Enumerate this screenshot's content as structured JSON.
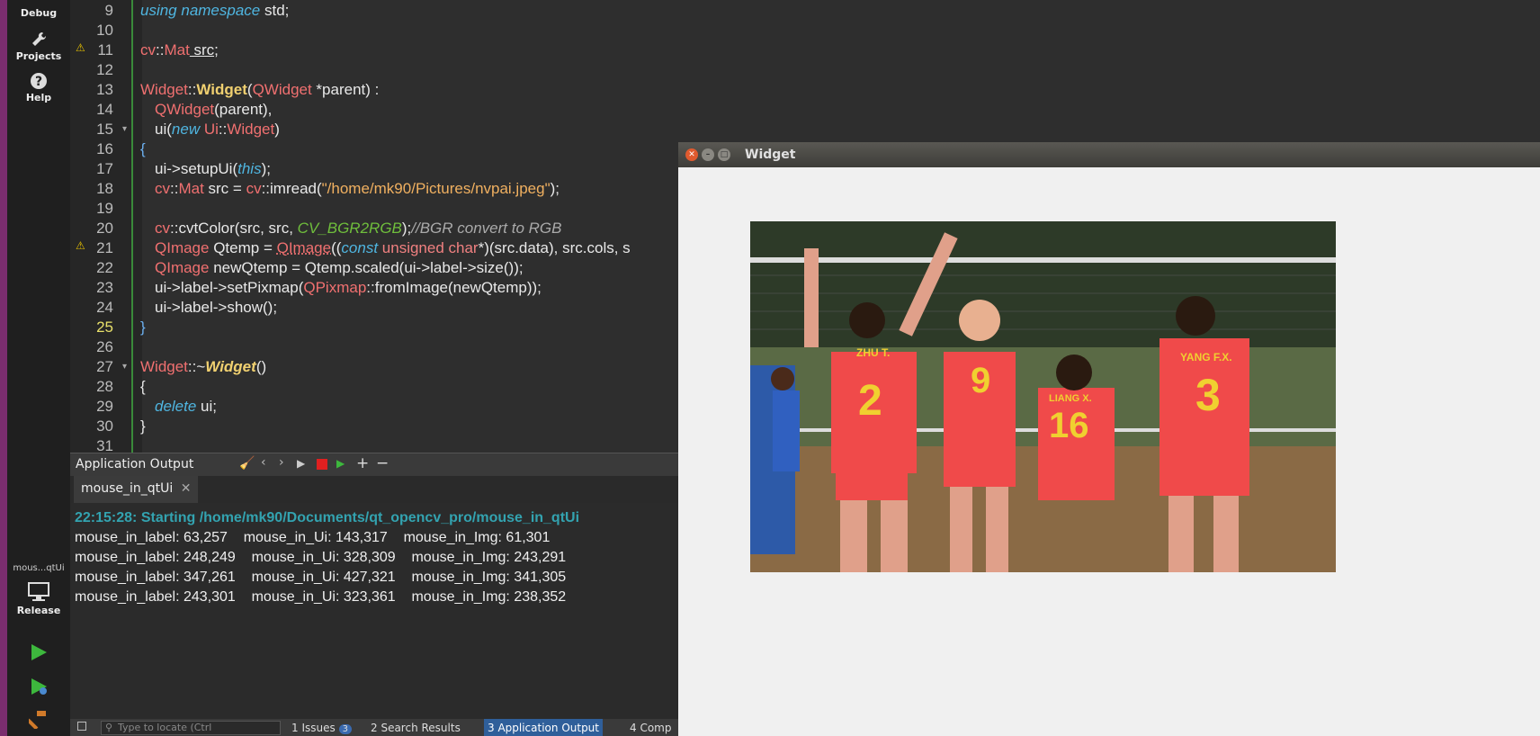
{
  "sidebar": {
    "debug_label": "Debug",
    "projects_label": "Projects",
    "help_label": "Help",
    "kit_project": "mous...qtUi",
    "kit_config": "Release"
  },
  "editor": {
    "line_numbers": [
      "9",
      "10",
      "11",
      "12",
      "13",
      "14",
      "15",
      "16",
      "17",
      "18",
      "19",
      "20",
      "21",
      "22",
      "23",
      "24",
      "25",
      "26",
      "27",
      "28",
      "29",
      "30",
      "31"
    ],
    "current_line": "25",
    "code": {
      "l9_kw": "using namespace",
      "l9_rest": " std;",
      "l11_type": "cv",
      "l11_sep": "::",
      "l11_mat": "Mat",
      "l11_rest": " src;",
      "l13_a": "Widget",
      "l13_b": "::",
      "l13_c": "Widget",
      "l13_d": "(",
      "l13_e": "QWidget",
      "l13_f": " *parent) :",
      "l14_a": "QWidget",
      "l14_b": "(parent),",
      "l15_a": "ui(",
      "l15_b": "new",
      "l15_c": " Ui",
      "l15_d": "::",
      "l15_e": "Widget",
      ")": ")",
      "l16": "{",
      "l17_a": "ui->setupUi(",
      "l17_b": "this",
      "l17_c": ");",
      "l18_a": "cv",
      "l18_b": "::",
      "l18_c": "Mat",
      "l18_d": " src = ",
      "l18_e": "cv",
      "l18_f": "::imread(",
      "l18_g": "\"/home/mk90/Pictures/nvpai.jpeg\"",
      "l18_h": ");",
      "l20_a": "cv",
      "l20_b": "::cvtColor(src, src, ",
      "l20_c": "CV_BGR2RGB",
      "l20_d": ");",
      "l20_e": "//BGR convert to RGB",
      "l21_a": "QImage",
      "l21_b": " Qtemp = ",
      "l21_c": "QImage",
      "l21_d": "((",
      "l21_e": "const",
      "l21_f": " unsigned char",
      "l21_g": "*)(src.data), src.cols, s",
      "l22_a": "QImage",
      "l22_b": " newQtemp = Qtemp.scaled(ui->label->size());",
      "l23_a": "ui->label->setPixmap(",
      "l23_b": "QPixmap",
      "l23_c": "::fromImage(newQtemp));",
      "l24": "ui->label->show();",
      "l25": "}",
      "l27_a": "Widget",
      "l27_b": "::~",
      "l27_c": "Widget",
      "l27_d": "()",
      "l28": "{",
      "l29_a": "delete",
      "l29_b": " ui;",
      "l30": "}"
    }
  },
  "output_pane": {
    "title": "Application Output",
    "tab_label": "mouse_in_qtUi",
    "start_line": "22:15:28: Starting /home/mk90/Documents/qt_opencv_pro/mouse_in_qtUi",
    "lines": [
      "mouse_in_label: 63,257    mouse_in_Ui: 143,317    mouse_in_Img: 61,301",
      "mouse_in_label: 248,249    mouse_in_Ui: 328,309    mouse_in_Img: 243,291",
      "mouse_in_label: 347,261    mouse_in_Ui: 427,321    mouse_in_Img: 341,305",
      "mouse_in_label: 243,301    mouse_in_Ui: 323,361    mouse_in_Img: 238,352"
    ]
  },
  "statusbar": {
    "locate_placeholder": "Type to locate (Ctrl",
    "tab1": "1  Issues",
    "tab1_badge": "3",
    "tab2": "2  Search Results",
    "tab3": "3  Application Output",
    "tab4": "4  Comp"
  },
  "widget_window": {
    "title": "Widget",
    "jerseys": {
      "n1": "2",
      "n2": "9",
      "n3": "16",
      "n4": "3",
      "name1": "ZHU T.",
      "name3": "LIANG X.",
      "name4": "YANG F.X."
    }
  },
  "colors": {
    "accent": "#33a3b0",
    "warning": "#e6c000",
    "run_green": "#3db83d"
  }
}
